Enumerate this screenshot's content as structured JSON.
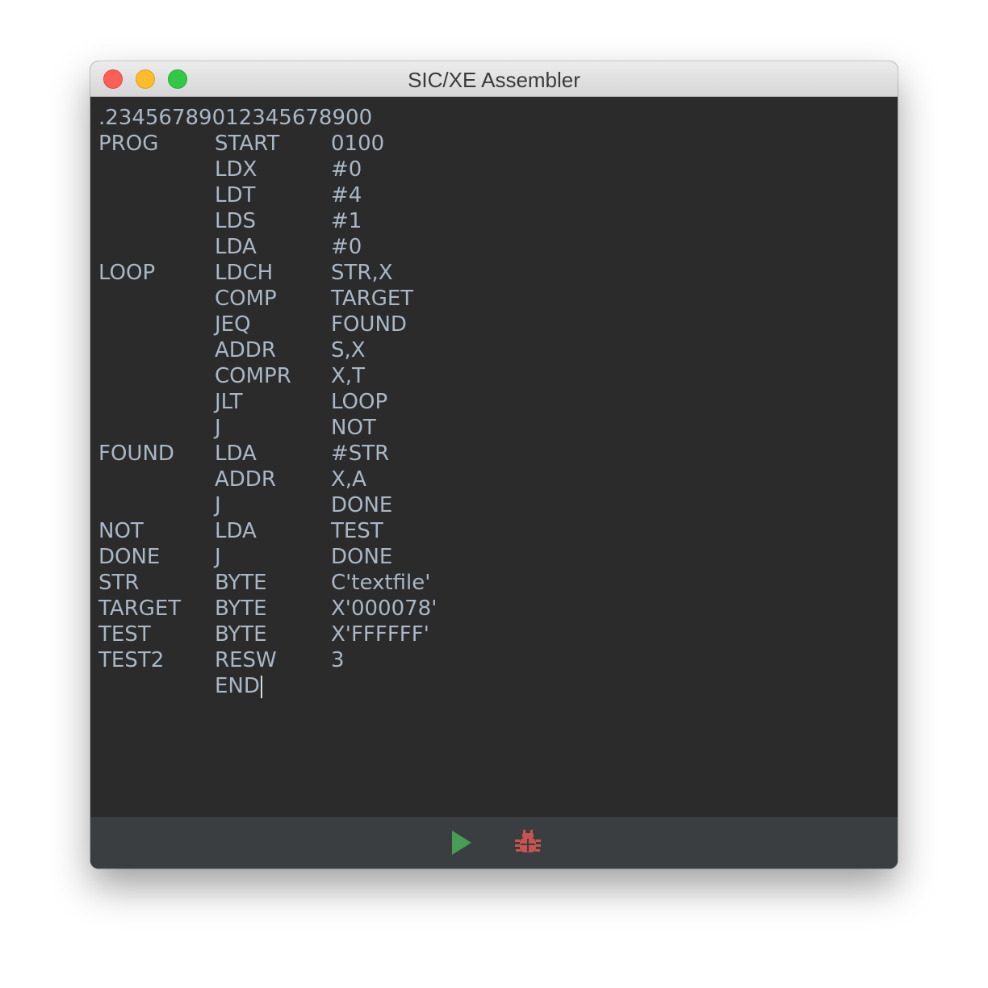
{
  "window": {
    "title": "SIC/XE Assembler"
  },
  "editor": {
    "comment_line": ".23456789012345678900",
    "lines": [
      {
        "label": "PROG",
        "op": "START",
        "arg": "0100"
      },
      {
        "label": "",
        "op": "LDX",
        "arg": "#0"
      },
      {
        "label": "",
        "op": "LDT",
        "arg": "#4"
      },
      {
        "label": "",
        "op": "LDS",
        "arg": "#1"
      },
      {
        "label": "",
        "op": "LDA",
        "arg": "#0"
      },
      {
        "label": "LOOP",
        "op": "LDCH",
        "arg": "STR,X"
      },
      {
        "label": "",
        "op": "COMP",
        "arg": "TARGET"
      },
      {
        "label": "",
        "op": "JEQ",
        "arg": "FOUND"
      },
      {
        "label": "",
        "op": "ADDR",
        "arg": "S,X"
      },
      {
        "label": "",
        "op": "COMPR",
        "arg": "X,T"
      },
      {
        "label": "",
        "op": "JLT",
        "arg": "LOOP"
      },
      {
        "label": "",
        "op": "J",
        "arg": "NOT"
      },
      {
        "label": "FOUND",
        "op": "LDA",
        "arg": "#STR"
      },
      {
        "label": "",
        "op": "ADDR",
        "arg": "X,A"
      },
      {
        "label": "",
        "op": "J",
        "arg": "DONE"
      },
      {
        "label": "NOT",
        "op": "LDA",
        "arg": "TEST"
      },
      {
        "label": "DONE",
        "op": "J",
        "arg": "DONE"
      },
      {
        "label": "STR",
        "op": "BYTE",
        "arg": "C'textfile'"
      },
      {
        "label": "TARGET",
        "op": "BYTE",
        "arg": "X'000078'"
      },
      {
        "label": "TEST",
        "op": "BYTE",
        "arg": "X'FFFFFF'"
      },
      {
        "label": "TEST2",
        "op": "RESW",
        "arg": "3"
      },
      {
        "label": "",
        "op": "END",
        "arg": ""
      }
    ]
  },
  "toolbar": {
    "run_icon": "play-icon",
    "debug_icon": "bug-icon"
  },
  "colors": {
    "editor_background": "#2b2b2b",
    "editor_text": "#a9b7c6",
    "toolbar_background": "#3b3e40",
    "run_green": "#499c54",
    "debug_red": "#c75450",
    "close_red": "#fc5f57",
    "minimize_yellow": "#fdbc2e",
    "maximize_green": "#33c748"
  }
}
